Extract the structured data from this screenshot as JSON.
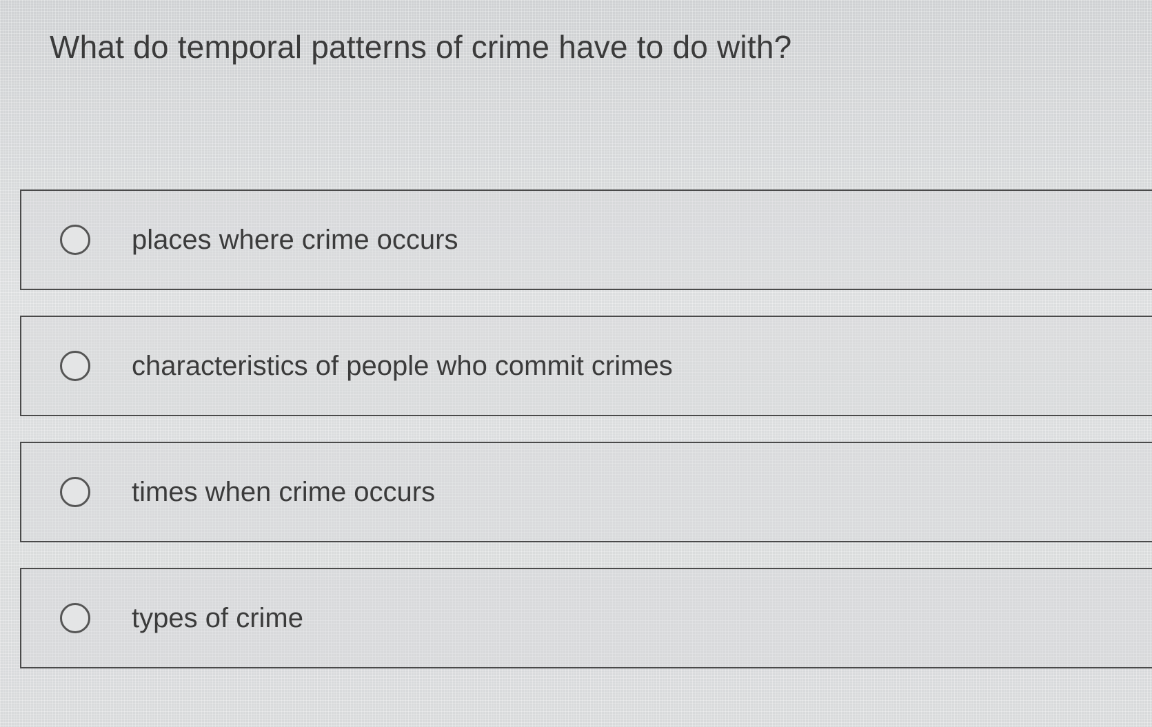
{
  "question": "What do temporal patterns of crime have to do with?",
  "options": [
    {
      "label": "places where crime occurs",
      "selected": false
    },
    {
      "label": "characteristics of people who commit crimes",
      "selected": false
    },
    {
      "label": "times when crime occurs",
      "selected": false
    },
    {
      "label": "types of crime",
      "selected": false
    }
  ]
}
